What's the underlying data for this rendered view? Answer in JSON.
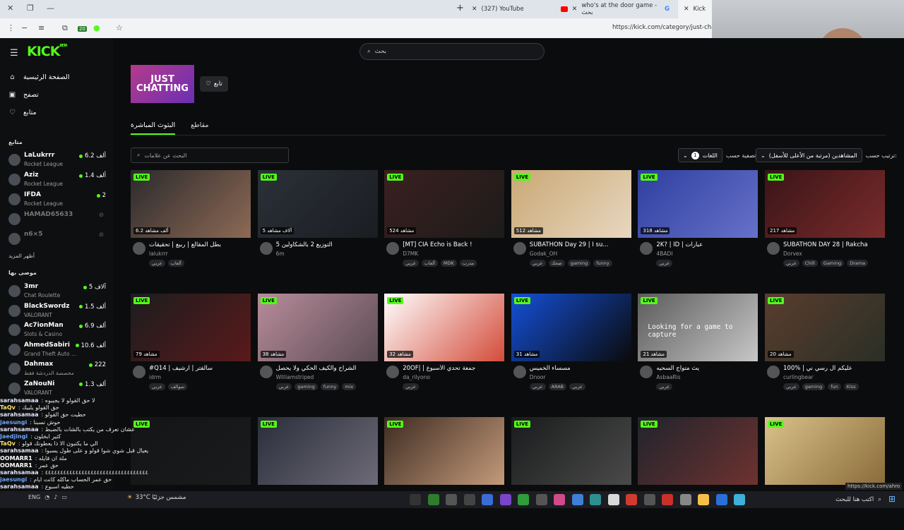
{
  "browser": {
    "tabs": [
      {
        "label": "(327) YouTube",
        "favicon_color": "#ff0000"
      },
      {
        "label": "who's at the door game - بحث",
        "favicon_color": "#4285f4"
      },
      {
        "label": "Kick",
        "favicon_color": "#53fc18"
      }
    ],
    "new_tab": "+",
    "url": "https://kick.com/category/just-chatting",
    "badge_count": "20"
  },
  "kick": {
    "logo": "KICK",
    "logo_sup": "BETA",
    "search_placeholder": "بحث",
    "nav": [
      {
        "label": "الصفحة الرئيسية",
        "icon": "home-icon",
        "glyph": "⌂"
      },
      {
        "label": "تصفح",
        "icon": "browse-icon",
        "glyph": "▣"
      },
      {
        "label": "متابع",
        "icon": "heart-icon",
        "glyph": "♡"
      }
    ],
    "following_title": "متابع",
    "following": [
      {
        "name": "LaLukrrr",
        "sub": "Rocket League",
        "viewers": "6.2 ألف",
        "online": true
      },
      {
        "name": "Aziz",
        "sub": "Rocket League",
        "viewers": "1.4 ألف",
        "online": true
      },
      {
        "name": "IFDA",
        "sub": "Rocket League",
        "viewers": "2",
        "online": true
      },
      {
        "name": "HAMAD65633",
        "sub": "",
        "viewers": "",
        "online": false
      },
      {
        "name": "n6×5",
        "sub": "",
        "viewers": "",
        "online": false
      }
    ],
    "show_more": "أظهر المزيد",
    "recommended_title": "موصى بها",
    "recommended": [
      {
        "name": "3mr",
        "sub": "Chat Roulette",
        "viewers": "5 آلاف"
      },
      {
        "name": "BlackSwordz",
        "sub": "VALORANT",
        "viewers": "1.5 ألف"
      },
      {
        "name": "Ac7ionMan",
        "sub": "Slots & Casino",
        "viewers": "6.9 ألف"
      },
      {
        "name": "AhmedSabiri",
        "sub": "Grand Theft Auto ...",
        "viewers": "10.6 ألف"
      },
      {
        "name": "Dahmax",
        "sub": "مخصصة الدردشة فقط",
        "viewers": "222"
      },
      {
        "name": "ZaNouNi",
        "sub": "VALORANT",
        "viewers": "1.3 ألف"
      }
    ],
    "category": {
      "name_line1": "JUST",
      "name_line2": "CHATTING",
      "follow": "تابع"
    },
    "tabs": [
      {
        "label": "البثوث المباشرة",
        "active": true
      },
      {
        "label": "مقاطع",
        "active": false
      }
    ],
    "tag_search_placeholder": "البحث عن علامات",
    "sort_label": "ترتيب حسب:",
    "sort_value": "المشاهدين (مرتبة من الأعلى للأسفل)",
    "filter_label": "تصفية حسب:",
    "filter_value": "اللغات",
    "filter_count": "1",
    "live_badge": "LIVE",
    "streams": [
      {
        "title": "بطل المقالع | ربيع | تحقيقات",
        "channel": "lalukrrr",
        "viewers": "6.2 ألف مشاهد",
        "tags": [
          "عربي",
          "ألعاب"
        ],
        "c1": "#2b2a2c",
        "c2": "#8d6a55"
      },
      {
        "title": "التوزيع 2 بالشكاولين 5",
        "channel": "6m",
        "viewers": "5 آلاف مشاهد",
        "tags": [],
        "c1": "#2c3038",
        "c2": "#1a1d22"
      },
      {
        "title": "[MT] CIA Echo is Back !",
        "channel": "D7MK",
        "viewers": "524 مشاهد",
        "tags": [
          "عربي",
          "ألعاب",
          "MDK",
          "مدرب"
        ],
        "c1": "#3a2020",
        "c2": "#1d1b1a"
      },
      {
        "title": "SUBATHON Day 29 | I su...",
        "channel": "Godak_OH",
        "viewers": "512 مشاهد",
        "tags": [
          "عربي",
          "ضحك",
          "gaming",
          "funny"
        ],
        "c1": "#c9a874",
        "c2": "#e8d7c0"
      },
      {
        "title": "2K? | ID | عبارات",
        "channel": "4BADI",
        "viewers": "318 مشاهد",
        "tags": [
          "عربي"
        ],
        "c1": "#2f3fa0",
        "c2": "#6671c9"
      },
      {
        "title": "SUBATHON DAY 28 | Rakcha",
        "channel": "Dorvex",
        "viewers": "217 مشاهد",
        "tags": [
          "عربي",
          "Chill",
          "Gaming",
          "Drama"
        ],
        "c1": "#3a1418",
        "c2": "#7a2b2b"
      },
      {
        "title": "#Q14 | سالفتر | ارشيف",
        "channel": "idrm",
        "viewers": "79 مشاهد",
        "tags": [
          "عربي",
          "سوالف"
        ],
        "c1": "#1c1c1e",
        "c2": "#5a1a1a"
      },
      {
        "title": "الشراح والكيف الحكي ولا يحصل",
        "channel": "Williamstriped",
        "viewers": "38 مشاهد",
        "tags": [
          "عربي",
          "gaming",
          "funny",
          "mix"
        ],
        "c1": "#b88c9a",
        "c2": "#5c4c55"
      },
      {
        "title": "20OF| | جمعة تحدي الأسبوع",
        "channel": "da_rilyono",
        "viewers": "32 مشاهد",
        "tags": [
          "عربي"
        ],
        "c1": "#ffffff",
        "c2": "#d34c3a"
      },
      {
        "title": "مسساء الخميس",
        "channel": "Dnoor",
        "viewers": "31 مشاهد",
        "tags": [
          "عربي",
          "ARAB",
          "عربي"
        ],
        "c1": "#1450d8",
        "c2": "#0a0a0a"
      },
      {
        "title": "يث متواج السحيه",
        "channel": "AsbaaRis",
        "viewers": "21 مشاهد",
        "tags": [
          "عربي"
        ],
        "c1": "#5b5b5b",
        "c2": "#c7c7c7",
        "overlay": "Looking for a game to capture"
      },
      {
        "title": "100% | عليكم ال رسي ني",
        "channel": "curlingbear",
        "viewers": "20 مشاهد",
        "tags": [
          "عربي",
          "gaming",
          "fun",
          "Kiss"
        ],
        "c1": "#5a3d2e",
        "c2": "#2a2f26"
      },
      {
        "title": "",
        "channel": "",
        "viewers": "",
        "tags": [],
        "c1": "#141516",
        "c2": "#1a1b1c"
      },
      {
        "title": "",
        "channel": "",
        "viewers": "",
        "tags": [],
        "c1": "#2a2e3a",
        "c2": "#6e6a78"
      },
      {
        "title": "",
        "channel": "",
        "viewers": "",
        "tags": [],
        "c1": "#3d2c22",
        "c2": "#c49a7a"
      },
      {
        "title": "",
        "channel": "",
        "viewers": "",
        "tags": [],
        "c1": "#1a1b1c",
        "c2": "#4a4a4a"
      },
      {
        "title": "",
        "channel": "",
        "viewers": "",
        "tags": [],
        "c1": "#20242c",
        "c2": "#6e3230"
      },
      {
        "title": "",
        "channel": "",
        "viewers": "",
        "tags": [],
        "c1": "#d9c28a",
        "c2": "#8a6b3a"
      }
    ]
  },
  "chat_overlay": [
    {
      "user": "sarahsamaa",
      "msg": ": لا حق القولو لا يجيبوه",
      "color": "#e8e8ff"
    },
    {
      "user": "TaQv",
      "msg": ": حق القولو يلبيك",
      "color": "#ffe36e"
    },
    {
      "user": "sarahsamaa",
      "msg": ": حطيت حق القولو",
      "color": "#e8e8ff"
    },
    {
      "user": "jaesungi",
      "msg": ": حوش نسبنا",
      "color": "#6fa7ff"
    },
    {
      "user": "sarahsamaa",
      "msg": ": عشان تعرف من يكتب بالشات بالضبط",
      "color": "#e8e8ff"
    },
    {
      "user": "Jaedjingi",
      "msg": ": كثير ابخلون",
      "color": "#6fa7ff"
    },
    {
      "user": "TaQv",
      "msg": ": الي ما يكتبون الا ذا يعطونك قولو",
      "color": "#ffe36e"
    },
    {
      "user": "sarahsamaa",
      "msg": ": يعيال قبل شوي شوا قولو و على طول يسبوا",
      "color": "#e8e8ff"
    },
    {
      "user": "OOMARR1",
      "msg": ": ملة ان قايله",
      "color": "#ffffff"
    },
    {
      "user": "OOMARR1",
      "msg": ": حق عمر",
      "color": "#ffffff"
    },
    {
      "user": "sarahsamaa",
      "msg": ": ٤٤٤٤٤٤٤٤٤٤٤٤٤٤٤٤٤٤٤٤٤٤٤٤٤٤٤٤٤٤٤٤٤٤",
      "color": "#e8e8ff"
    },
    {
      "user": "jaesungi",
      "msg": ": حق عمر الحساب ماكله كانت ايام",
      "color": "#6fa7ff"
    },
    {
      "user": "sarahsamaa",
      "msg": ": حطيه اسبوع",
      "color": "#e8e8ff"
    }
  ],
  "taskbar": {
    "weather": "33°C مشمس جزئيًا",
    "search": "اكتب هنا للبحث",
    "lang": "ENG",
    "status_url": "https://kick.com/ahro"
  }
}
